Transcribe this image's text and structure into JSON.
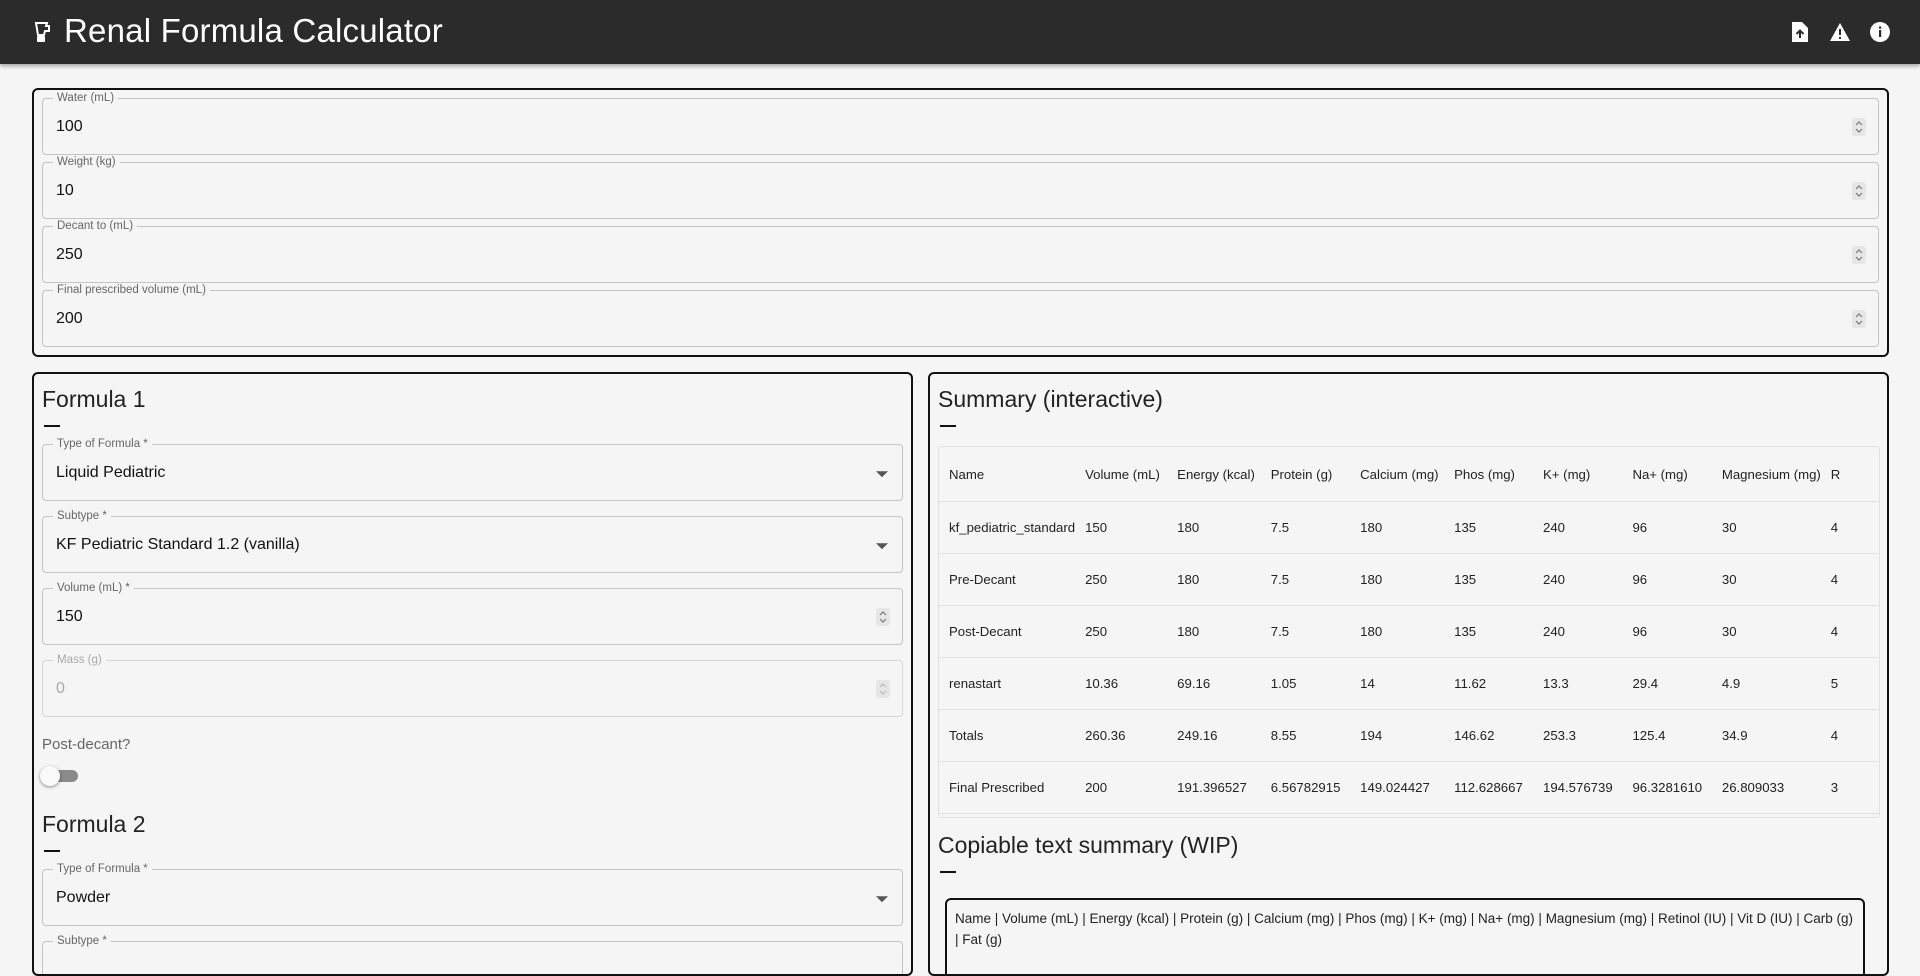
{
  "app": {
    "title": "Renal Formula Calculator",
    "logo_icon": "blender-icon",
    "actions": [
      {
        "icon": "file-upload-icon"
      },
      {
        "icon": "warning-icon"
      },
      {
        "icon": "info-icon"
      }
    ]
  },
  "inputs": {
    "water": {
      "label": "Water (mL)",
      "value": "100"
    },
    "weight": {
      "label": "Weight (kg)",
      "value": "10"
    },
    "decant": {
      "label": "Decant to (mL)",
      "value": "250"
    },
    "final": {
      "label": "Final prescribed volume (mL)",
      "value": "200"
    }
  },
  "formula1": {
    "title": "Formula 1",
    "type": {
      "label": "Type of Formula *",
      "value": "Liquid Pediatric"
    },
    "subtype": {
      "label": "Subtype *",
      "value": "KF Pediatric Standard 1.2 (vanilla)"
    },
    "volume": {
      "label": "Volume (mL) *",
      "value": "150"
    },
    "mass": {
      "label": "Mass (g)",
      "value": "0"
    },
    "post_decant_label": "Post-decant?",
    "post_decant": false
  },
  "formula2": {
    "title": "Formula 2",
    "type": {
      "label": "Type of Formula *",
      "value": "Powder"
    },
    "subtype": {
      "label": "Subtype *",
      "value": ""
    }
  },
  "summary": {
    "title": "Summary (interactive)",
    "columns": [
      "Name",
      "Volume (mL)",
      "Energy (kcal)",
      "Protein (g)",
      "Calcium (mg)",
      "Phos (mg)",
      "K+ (mg)",
      "Na+ (mg)",
      "Magnesium (mg)",
      "R"
    ],
    "rows": [
      [
        "kf_pediatric_standard",
        "150",
        "180",
        "7.5",
        "180",
        "135",
        "240",
        "96",
        "30",
        "4"
      ],
      [
        "Pre-Decant",
        "250",
        "180",
        "7.5",
        "180",
        "135",
        "240",
        "96",
        "30",
        "4"
      ],
      [
        "Post-Decant",
        "250",
        "180",
        "7.5",
        "180",
        "135",
        "240",
        "96",
        "30",
        "4"
      ],
      [
        "renastart",
        "10.36",
        "69.16",
        "1.05",
        "14",
        "11.62",
        "13.3",
        "29.4",
        "4.9",
        "5"
      ],
      [
        "Totals",
        "260.36",
        "249.16",
        "8.55",
        "194",
        "146.62",
        "253.3",
        "125.4",
        "34.9",
        "4"
      ],
      [
        "Final Prescribed",
        "200",
        "191.396527",
        "6.56782915",
        "149.024427",
        "112.628667",
        "194.576739",
        "96.3281610",
        "26.809033",
        "3"
      ]
    ]
  },
  "copy": {
    "title": "Copiable text summary (WIP)",
    "text": "Name | Volume (mL) | Energy (kcal) | Protein (g) | Calcium (mg) | Phos (mg) | K+ (mg) | Na+ (mg) | Magnesium (mg) | Retinol (IU) | Vit D (IU) | Carb (g) | Fat (g)"
  }
}
